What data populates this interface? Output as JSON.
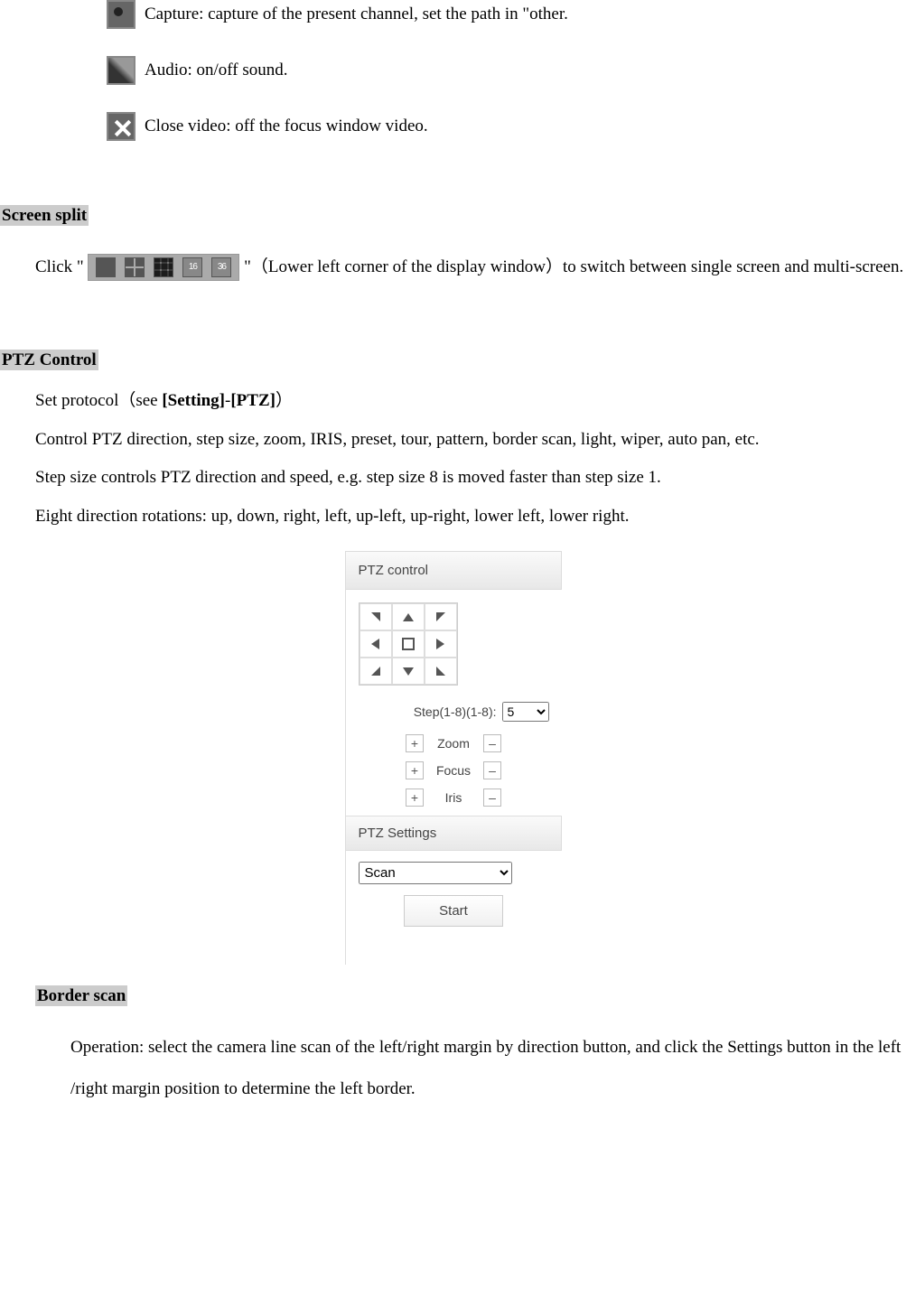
{
  "items": [
    {
      "label": "Capture: capture of the present channel, set the path in \"other."
    },
    {
      "label": "Audio: on/off sound."
    },
    {
      "label": "Close video: off the focus window video."
    }
  ],
  "screen_split": {
    "heading": "Screen split",
    "click_prefix": "Click \"",
    "click_suffix": "\"（Lower left corner of the display window）to switch between single screen and multi-screen.",
    "num16": "16",
    "num36": "36"
  },
  "ptz": {
    "heading": "PTZ Control",
    "line1_pre": "Set protocol（see ",
    "line1_bold1": "[Setting]",
    "line1_dash": "-",
    "line1_bold2": "[PTZ]",
    "line1_post": "）",
    "line2": "Control PTZ direction, step size, zoom, IRIS, preset, tour, pattern, border scan, light, wiper, auto pan, etc.",
    "line3": "Step size controls PTZ direction and speed, e.g. step size 8 is moved faster than step size 1.",
    "line4": "Eight direction rotations: up, down, right, left, up-left, up-right, lower left, lower right."
  },
  "panel": {
    "title": "PTZ control",
    "step_label": "Step(1-8)(1-8):",
    "step_value": "5",
    "zoom": "Zoom",
    "focus": "Focus",
    "iris": "Iris",
    "plus": "+",
    "minus": "–",
    "settings_title": "PTZ Settings",
    "scan_option": "Scan",
    "start_btn": "Start"
  },
  "border_scan": {
    "heading": "Border scan",
    "body": "Operation: select the camera line scan of the left/right margin by direction button, and click the Settings button in the left /right margin position to determine the left border."
  }
}
